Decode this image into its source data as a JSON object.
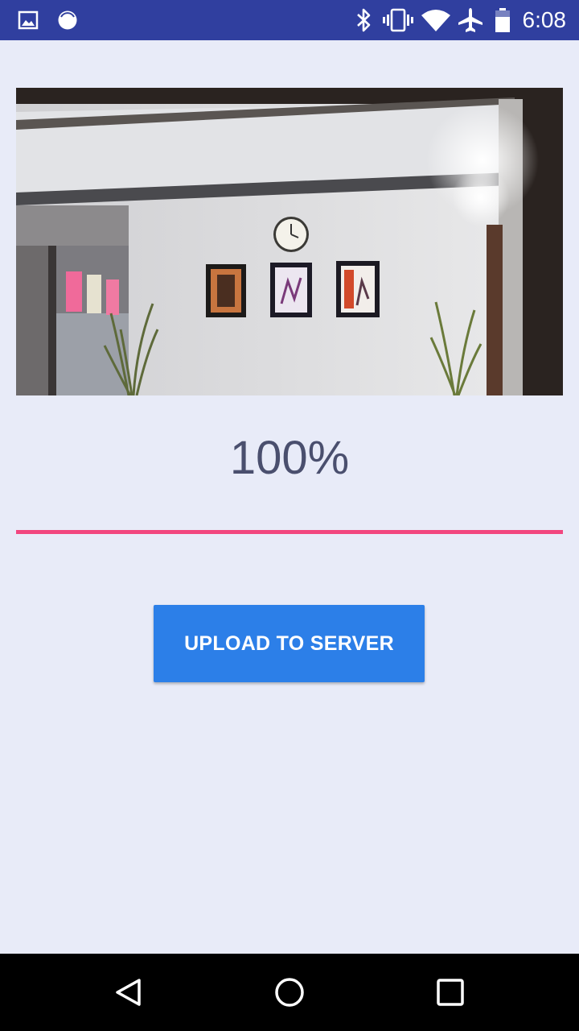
{
  "status_bar": {
    "time": "6:08",
    "icons": [
      "gallery-icon",
      "record-icon",
      "bluetooth-icon",
      "vibrate-icon",
      "wifi-icon",
      "airplane-mode-icon",
      "battery-icon"
    ],
    "background": "#303f9f"
  },
  "main": {
    "image": "office-wall-photo",
    "progress_text": "100%",
    "progress": 1.0,
    "upload_button_label": "UPLOAD TO SERVER"
  },
  "colors": {
    "background": "#e8ebf8",
    "accent": "#f2467f",
    "button": "#2c7fe8"
  },
  "nav_bar": {
    "buttons": [
      "back-icon",
      "home-icon",
      "recents-icon"
    ]
  }
}
